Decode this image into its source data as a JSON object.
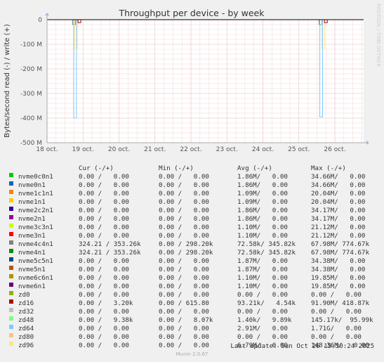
{
  "chart_data": {
    "type": "line",
    "title": "Throughput per device - by week",
    "ylabel": "Bytes/second read (-) / write (+)",
    "watermark": "RRDTOOL / TOBI OETIKER",
    "x_ticks": [
      "18 oct.",
      "19 oct.",
      "20 oct.",
      "21 oct.",
      "22 oct.",
      "23 oct.",
      "24 oct.",
      "25 oct.",
      "26 oct."
    ],
    "y_ticks": [
      "0",
      "-100 M",
      "-200 M",
      "-300 M",
      "-400 M",
      "-500 M"
    ],
    "y_tick_values": [
      0,
      -100000000,
      -200000000,
      -300000000,
      -400000000,
      -500000000
    ],
    "ylim": [
      -500000000,
      0
    ],
    "x_range_days": [
      0,
      8.8
    ],
    "grid": true,
    "spikes": [
      {
        "x_day": 0.75,
        "series": "nvme4c4n1",
        "read_min": -20000000
      },
      {
        "x_day": 0.78,
        "series": "zd64",
        "read_min": -400000000
      },
      {
        "x_day": 0.8,
        "series": "zd96",
        "read_min": -120000000
      },
      {
        "x_day": 0.9,
        "series": "zd16",
        "read_min": -12000000
      },
      {
        "x_day": 7.6,
        "series": "nvme4c4n1",
        "read_min": -20000000
      },
      {
        "x_day": 7.62,
        "series": "zd64",
        "read_min": -395000000
      },
      {
        "x_day": 7.67,
        "series": "zd96",
        "read_min": -120000000
      },
      {
        "x_day": 7.75,
        "series": "zd16",
        "read_min": -12000000
      }
    ]
  },
  "legend": {
    "headers": {
      "cur": "Cur (-/+)",
      "min": "Min (-/+)",
      "avg": "Avg (-/+)",
      "max": "Max (-/+)"
    },
    "rows": [
      {
        "name": "nvme0c0n1",
        "color": "#00cc00",
        "cur": "0.00 /   0.00",
        "min": "0.00 /   0.00",
        "avg": "1.86M/   0.00",
        "max": "34.66M/   0.00"
      },
      {
        "name": "nvme0n1",
        "color": "#0066b3",
        "cur": "0.00 /   0.00",
        "min": "0.00 /   0.00",
        "avg": "1.86M/   0.00",
        "max": "34.66M/   0.00"
      },
      {
        "name": "nvme1c1n1",
        "color": "#ff8000",
        "cur": "0.00 /   0.00",
        "min": "0.00 /   0.00",
        "avg": "1.09M/   0.00",
        "max": "20.04M/   0.00"
      },
      {
        "name": "nvme1n1",
        "color": "#ffcc00",
        "cur": "0.00 /   0.00",
        "min": "0.00 /   0.00",
        "avg": "1.09M/   0.00",
        "max": "20.04M/   0.00"
      },
      {
        "name": "nvme2c2n1",
        "color": "#330099",
        "cur": "0.00 /   0.00",
        "min": "0.00 /   0.00",
        "avg": "1.86M/   0.00",
        "max": "34.17M/   0.00"
      },
      {
        "name": "nvme2n1",
        "color": "#990099",
        "cur": "0.00 /   0.00",
        "min": "0.00 /   0.00",
        "avg": "1.86M/   0.00",
        "max": "34.17M/   0.00"
      },
      {
        "name": "nvme3c3n1",
        "color": "#ccff00",
        "cur": "0.00 /   0.00",
        "min": "0.00 /   0.00",
        "avg": "1.10M/   0.00",
        "max": "21.12M/   0.00"
      },
      {
        "name": "nvme3n1",
        "color": "#ff0000",
        "cur": "0.00 /   0.00",
        "min": "0.00 /   0.00",
        "avg": "1.10M/   0.00",
        "max": "21.12M/   0.00"
      },
      {
        "name": "nvme4c4n1",
        "color": "#808080",
        "cur": "324.21 / 353.26k",
        "min": "0.00 / 298.20k",
        "avg": "72.58k/ 345.82k",
        "max": "67.98M/ 774.67k"
      },
      {
        "name": "nvme4n1",
        "color": "#008f00",
        "cur": "324.21 / 353.26k",
        "min": "0.00 / 298.20k",
        "avg": "72.58k/ 345.82k",
        "max": "67.98M/ 774.67k"
      },
      {
        "name": "nvme5c5n1",
        "color": "#00487d",
        "cur": "0.00 /   0.00",
        "min": "0.00 /   0.00",
        "avg": "1.87M/   0.00",
        "max": "34.38M/   0.00"
      },
      {
        "name": "nvme5n1",
        "color": "#b35a00",
        "cur": "0.00 /   0.00",
        "min": "0.00 /   0.00",
        "avg": "1.87M/   0.00",
        "max": "34.38M/   0.00"
      },
      {
        "name": "nvme6c6n1",
        "color": "#b38f00",
        "cur": "0.00 /   0.00",
        "min": "0.00 /   0.00",
        "avg": "1.10M/   0.00",
        "max": "19.85M/   0.00"
      },
      {
        "name": "nvme6n1",
        "color": "#6b006b",
        "cur": "0.00 /   0.00",
        "min": "0.00 /   0.00",
        "avg": "1.10M/   0.00",
        "max": "19.85M/   0.00"
      },
      {
        "name": "zd0",
        "color": "#8fb300",
        "cur": "0.00 /   0.00",
        "min": "0.00 /   0.00",
        "avg": "0.00 /   0.00",
        "max": "0.00 /   0.00"
      },
      {
        "name": "zd16",
        "color": "#b30000",
        "cur": "0.00 /   3.20k",
        "min": "0.00 / 615.80",
        "avg": "93.21k/   4.54k",
        "max": "91.90M/ 418.87k"
      },
      {
        "name": "zd32",
        "color": "#bebebe",
        "cur": "0.00 /   0.00",
        "min": "0.00 /   0.00",
        "avg": "0.00 /   0.00",
        "max": "0.00 /   0.00"
      },
      {
        "name": "zd48",
        "color": "#80ff80",
        "cur": "0.00 /   9.38k",
        "min": "0.00 /   8.07k",
        "avg": "1.40k/   9.89k",
        "max": "145.17k/  95.99k"
      },
      {
        "name": "zd64",
        "color": "#80c9ff",
        "cur": "0.00 /   0.00",
        "min": "0.00 /   0.00",
        "avg": "2.91M/   0.00",
        "max": "1.71G/   0.00"
      },
      {
        "name": "zd80",
        "color": "#ffc080",
        "cur": "0.00 /   0.00",
        "min": "0.00 /   0.00",
        "avg": "0.00 /   0.00",
        "max": "0.00 /   0.00"
      },
      {
        "name": "zd96",
        "color": "#ffe680",
        "cur": "0.00 /   0.00",
        "min": "0.00 /   0.00",
        "avg": "6.79M/   0.00",
        "max": "148.36M/   0.00"
      }
    ]
  },
  "footer": {
    "last_update": "Last update: Sun Oct 26 15:30:24 2025",
    "version": "Munin 2.0.67"
  }
}
